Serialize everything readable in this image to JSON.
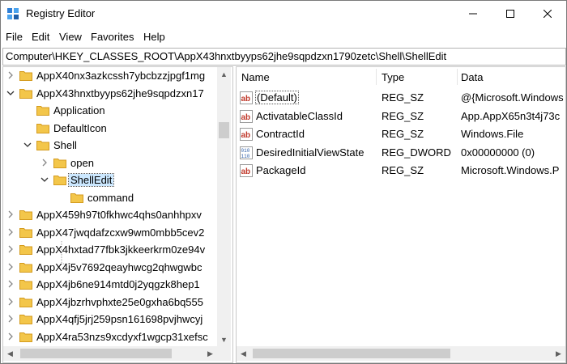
{
  "window": {
    "title": "Registry Editor"
  },
  "menu": [
    "File",
    "Edit",
    "View",
    "Favorites",
    "Help"
  ],
  "address": "Computer\\HKEY_CLASSES_ROOT\\AppX43hnxtbyyps62jhe9sqpdzxn1790zetc\\Shell\\ShellEdit",
  "tree": [
    {
      "label": "AppX40nx3azkcssh7ybcbzzjpgf1mg",
      "expander": "collapsed",
      "indent": 0
    },
    {
      "label": "AppX43hnxtbyyps62jhe9sqpdzxn17",
      "expander": "expanded",
      "indent": 0
    },
    {
      "label": "Application",
      "expander": "none",
      "indent": 1
    },
    {
      "label": "DefaultIcon",
      "expander": "none",
      "indent": 1
    },
    {
      "label": "Shell",
      "expander": "expanded",
      "indent": 1
    },
    {
      "label": "open",
      "expander": "collapsed",
      "indent": 2
    },
    {
      "label": "ShellEdit",
      "expander": "expanded",
      "indent": 2,
      "selected": true
    },
    {
      "label": "command",
      "expander": "none",
      "indent": 3
    },
    {
      "label": "AppX459h97t0fkhwc4qhs0anhhpxv",
      "expander": "collapsed",
      "indent": 0
    },
    {
      "label": "AppX47jwqdafzcxw9wm0mbb5cev2",
      "expander": "collapsed",
      "indent": 0
    },
    {
      "label": "AppX4hxtad77fbk3jkkeerkrm0ze94v",
      "expander": "collapsed",
      "indent": 0
    },
    {
      "label": "AppX4j5v7692qeayhwcg2qhwgwbc",
      "expander": "collapsed",
      "indent": 0
    },
    {
      "label": "AppX4jb6ne914mtd0j2yqgzk8hep1",
      "expander": "collapsed",
      "indent": 0
    },
    {
      "label": "AppX4jbzrhvphxte25e0gxha6bq555",
      "expander": "collapsed",
      "indent": 0
    },
    {
      "label": "AppX4qfj5jrj259psn161698pvjhwcyj",
      "expander": "collapsed",
      "indent": 0
    },
    {
      "label": "AppX4ra53nzs9xcdyxf1wgcp31xefsc",
      "expander": "collapsed",
      "indent": 0
    }
  ],
  "columns": {
    "name": "Name",
    "type": "Type",
    "data": "Data"
  },
  "values": [
    {
      "name": "(Default)",
      "type": "REG_SZ",
      "data": "@{Microsoft.Windows",
      "icon": "string-value-icon"
    },
    {
      "name": "ActivatableClassId",
      "type": "REG_SZ",
      "data": "App.AppX65n3t4j73c",
      "icon": "string-value-icon"
    },
    {
      "name": "ContractId",
      "type": "REG_SZ",
      "data": "Windows.File",
      "icon": "string-value-icon"
    },
    {
      "name": "DesiredInitialViewState",
      "type": "REG_DWORD",
      "data": "0x00000000 (0)",
      "icon": "binary-value-icon"
    },
    {
      "name": "PackageId",
      "type": "REG_SZ",
      "data": "Microsoft.Windows.P",
      "icon": "string-value-icon"
    }
  ],
  "colors": {
    "selection": "#cce8ff",
    "folder": "#f3c64a",
    "string_icon": "#c0392b",
    "dword_icon": "#2e5fa8"
  }
}
